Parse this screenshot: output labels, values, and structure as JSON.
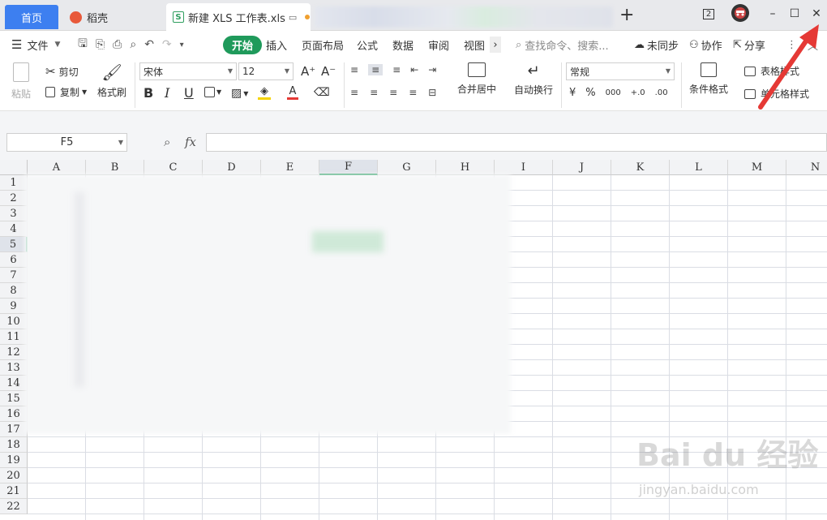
{
  "tabs": {
    "home": "首页",
    "daoke": "稻壳",
    "doc": "新建 XLS 工作表.xls",
    "plus": "+"
  },
  "window": {
    "badge": "2",
    "minimize": "–",
    "maximize": "☐",
    "close": "✕"
  },
  "menu": {
    "file": "文件",
    "tabs": [
      "开始",
      "插入",
      "页面布局",
      "公式",
      "数据",
      "审阅",
      "视图"
    ],
    "search_placeholder": "查找命令、搜索...",
    "sync": "未同步",
    "collab": "协作",
    "share": "分享"
  },
  "ribbon": {
    "paste": "粘贴",
    "cut": "剪切",
    "copy": "复制",
    "format_painter": "格式刷",
    "font_name": "宋体",
    "font_size": "12",
    "bold": "B",
    "italic": "I",
    "underline": "U",
    "merge_center": "合并居中",
    "wrap_text": "自动换行",
    "number_format": "常规",
    "currency": "¥",
    "percent": "%",
    "thousands": "000",
    "inc_decimal": "+.0",
    "dec_decimal": ".00",
    "conditional": "条件格式",
    "table_style": "表格样式",
    "cell_style": "单元格样式"
  },
  "formula": {
    "cell_ref": "F5",
    "fx": "fx"
  },
  "sheet": {
    "columns": [
      "A",
      "B",
      "C",
      "D",
      "E",
      "F",
      "G",
      "H",
      "I",
      "J",
      "K",
      "L",
      "M",
      "N"
    ],
    "rows": [
      "1",
      "2",
      "3",
      "4",
      "5",
      "6",
      "7",
      "8",
      "9",
      "10",
      "11",
      "12",
      "13",
      "14",
      "15",
      "16",
      "17",
      "18",
      "19",
      "20",
      "21",
      "22"
    ],
    "active_col": "F",
    "active_row": "5"
  },
  "watermark": {
    "main": "Bai du 经验",
    "sub": "jingyan.baidu.com"
  },
  "colors": {
    "accent": "#1f9a5b",
    "home_tab": "#3d7ff0",
    "arrow": "#e53935"
  }
}
